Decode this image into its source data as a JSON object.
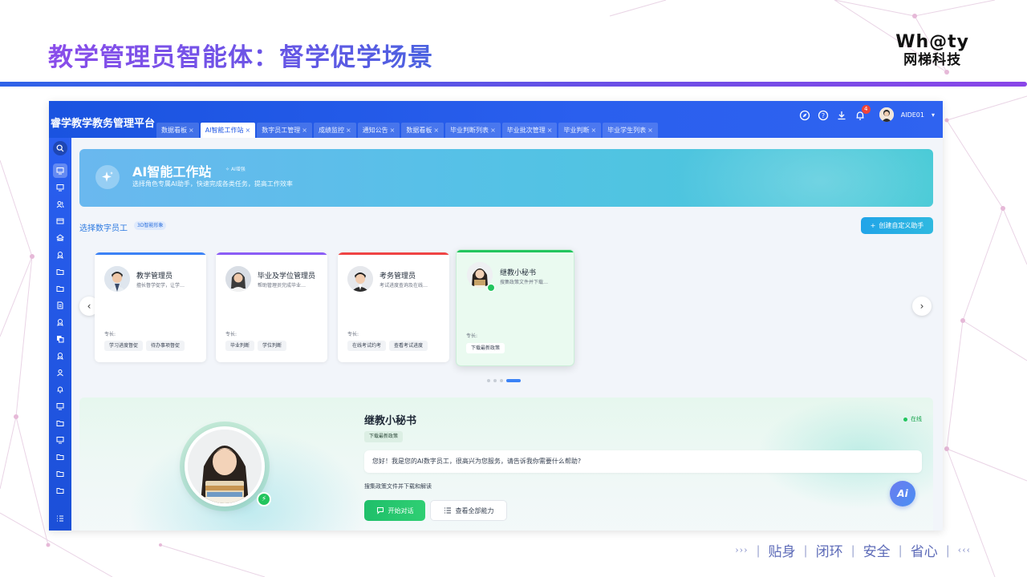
{
  "slide": {
    "title": "教学管理员智能体：督学促学场景",
    "brand_logo": "Wh@ty",
    "brand_name": "网梯科技",
    "footer_tags": [
      "贴身",
      "闭环",
      "安全",
      "省心"
    ]
  },
  "app": {
    "name": "睿学教学教务管理平台",
    "tabs": [
      {
        "label": "数据看板"
      },
      {
        "label": "AI智能工作站"
      },
      {
        "label": "数字员工管理"
      },
      {
        "label": "成绩监控"
      },
      {
        "label": "通知公告"
      },
      {
        "label": "数据看板"
      },
      {
        "label": "毕业判断列表"
      },
      {
        "label": "毕业批次管理"
      },
      {
        "label": "毕业判断"
      },
      {
        "label": "毕业学生列表"
      }
    ],
    "active_tab_index": 1,
    "notification_count": "4",
    "user_name": "AIDE01"
  },
  "hero": {
    "title": "AI智能工作站",
    "badge": "AI增强",
    "subtitle": "选择角色专属AI助手，快速完成各类任务，提高工作效率"
  },
  "section": {
    "title": "选择数字员工",
    "tag": "3D智能形象",
    "create_button": "创建自定义助手"
  },
  "cards": [
    {
      "name": "教学管理员",
      "desc": "擅长督学促学，让学…",
      "spec_label": "专长:",
      "chips": [
        "学习进度督促",
        "待办事项督促"
      ],
      "accent": "#3b82f6"
    },
    {
      "name": "毕业及学位管理员",
      "desc": "帮助管理员完成毕业…",
      "spec_label": "专长:",
      "chips": [
        "毕业判断",
        "学位判断"
      ],
      "accent": "#8b5cf6"
    },
    {
      "name": "考务管理员",
      "desc": "考试进度查询及在线…",
      "spec_label": "专长:",
      "chips": [
        "在线考试约考",
        "查看考试进度"
      ],
      "accent": "#ef4444"
    },
    {
      "name": "继教小秘书",
      "desc": "搜集政策文件并下载…",
      "spec_label": "专长:",
      "chips": [
        "下载最新政策"
      ],
      "accent": "#22c55e"
    }
  ],
  "carousel": {
    "page_count": 4,
    "active_page": 4
  },
  "detail": {
    "name": "继教小秘书",
    "status": "在线",
    "chip": "下载最新政策",
    "greeting": "您好！我是您的AI数字员工，很高兴为您服务，请告诉我你需要什么帮助?",
    "description": "搜集政策文件并下载和解读",
    "start_button": "开始对话",
    "all_button": "查看全部能力",
    "fab_label": "Ai"
  },
  "colors": {
    "primary_blue": "#1d56e6",
    "success_green": "#22c55e",
    "title_purple": "#7b4fe8"
  }
}
